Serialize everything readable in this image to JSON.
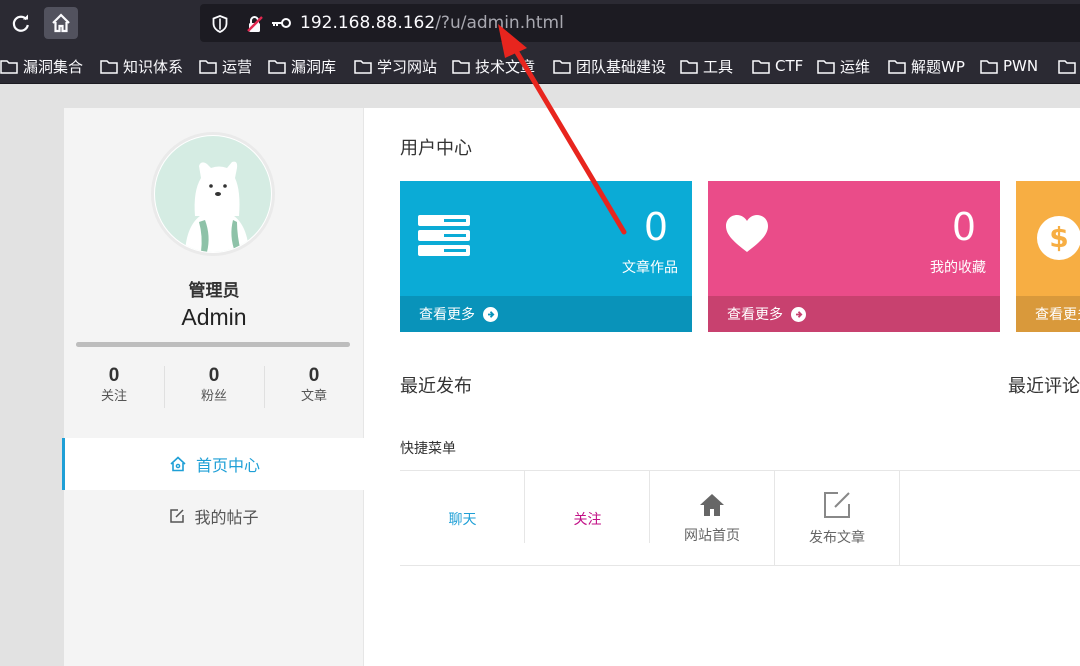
{
  "browser": {
    "url_host": "192.168.88.162",
    "url_path": "/?u/admin.html",
    "bookmarks": [
      "漏洞集合",
      "知识体系",
      "运营",
      "漏洞库",
      "学习网站",
      "技术文章",
      "团队基础建设",
      "工具",
      "CTF",
      "运维",
      "解题WP",
      "PWN"
    ]
  },
  "profile": {
    "role": "管理员",
    "name": "Admin",
    "stats": [
      {
        "value": "0",
        "label": "关注"
      },
      {
        "value": "0",
        "label": "粉丝"
      },
      {
        "value": "0",
        "label": "文章"
      }
    ]
  },
  "side_nav": [
    {
      "label": "首页中心",
      "icon": "home-icon",
      "active": true
    },
    {
      "label": "我的帖子",
      "icon": "edit-icon",
      "active": false
    }
  ],
  "main": {
    "title": "用户中心",
    "cards": [
      {
        "value": "0",
        "label": "文章作品",
        "more": "查看更多",
        "icon": "server-icon",
        "color": "#0babd6"
      },
      {
        "value": "0",
        "label": "我的收藏",
        "more": "查看更多",
        "icon": "heart-icon",
        "color": "#ea4c89"
      },
      {
        "more": "查看更多",
        "icon": "dollar-icon",
        "color": "#f7ae43"
      }
    ],
    "recent_posts_title": "最近发布",
    "recent_comments_title": "最近评论",
    "quick_menu_title": "快捷菜单",
    "quick_menu": [
      {
        "label": "聊天",
        "color": "#1e9fd6"
      },
      {
        "label": "关注",
        "color": "#c20f86"
      },
      {
        "label": "网站首页",
        "icon": "home-icon"
      },
      {
        "label": "发布文章",
        "icon": "edit-icon"
      }
    ]
  },
  "annotation": {
    "color": "#e8251e"
  }
}
